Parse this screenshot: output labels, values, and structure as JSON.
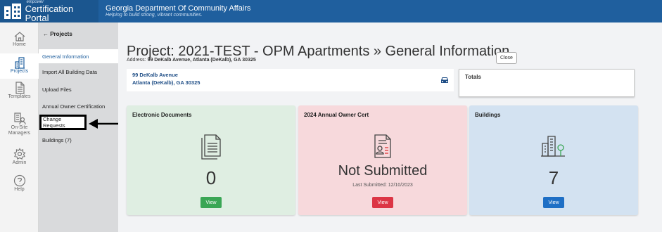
{
  "brand": {
    "small_text": "empower",
    "name": "Certification Portal"
  },
  "org": {
    "name": "Georgia Department Of Community Affairs",
    "tagline": "Helping to build strong, vibrant communities."
  },
  "rail": [
    {
      "label": "Home",
      "icon": "home-icon"
    },
    {
      "label": "Projects",
      "icon": "building-icon"
    },
    {
      "label": "Templates",
      "icon": "document-icon"
    },
    {
      "label": "On-Site Managers",
      "icon": "manager-icon"
    },
    {
      "label": "Admin",
      "icon": "gear-icon"
    },
    {
      "label": "Help",
      "icon": "help-icon"
    }
  ],
  "subnav": {
    "back_label": "← Projects",
    "items": [
      {
        "label": "General Information"
      },
      {
        "label": "Import All Building Data"
      },
      {
        "label": "Upload Files"
      },
      {
        "label": "Annual Owner Certification"
      },
      {
        "label": "Change Requests"
      },
      {
        "label": "Buildings (7)"
      }
    ]
  },
  "page": {
    "title": "Project: 2021-TEST - OPM Apartments » General Information",
    "address_prefix": "Address:",
    "address": "99 DeKalb Avenue, Atlanta (DeKalb), GA 30325",
    "close_label": "Close"
  },
  "address_card": {
    "line1": "99 DeKalb Avenue",
    "line2": "Atlanta (DeKalb), GA 30325"
  },
  "totals": {
    "title": "Totals"
  },
  "cards": [
    {
      "title": "Electronic Documents",
      "value": "0",
      "button": "View",
      "bg": "#dfeee2",
      "btn_color": "#3aa655"
    },
    {
      "title": "2024 Annual Owner Cert",
      "value": "Not Submitted",
      "sub": "Last Submitted: 12/10/2023",
      "button": "View",
      "bg": "#f7d9dc",
      "btn_color": "#dc3545"
    },
    {
      "title": "Buildings",
      "value": "7",
      "button": "View",
      "bg": "#d3e2f1",
      "btn_color": "#1e6fc5"
    }
  ]
}
